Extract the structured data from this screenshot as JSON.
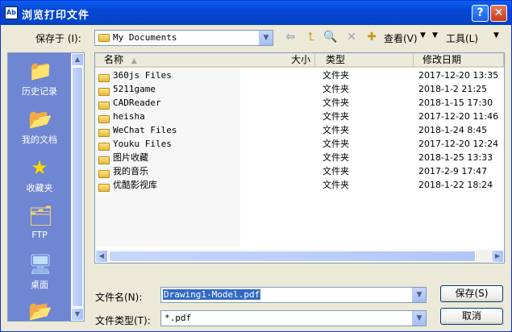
{
  "window": {
    "title": "浏览打印文件",
    "help_glyph": "?",
    "close_glyph": "✕",
    "app_icon_text": "Ab"
  },
  "lookin": {
    "label": "保存于 (I):",
    "value": "My Documents"
  },
  "toolbar": {
    "view_label": "查看(V)",
    "tools_label": "工具(L)"
  },
  "places": [
    {
      "label": "历史记录",
      "icon": "history-icon"
    },
    {
      "label": "我的文档",
      "icon": "my-documents-icon"
    },
    {
      "label": "收藏夹",
      "icon": "favorites-icon"
    },
    {
      "label": "FTP",
      "icon": "ftp-icon"
    },
    {
      "label": "桌面",
      "icon": "desktop-icon"
    }
  ],
  "columns": {
    "name": "名称",
    "size": "大小",
    "type": "类型",
    "modified": "修改日期"
  },
  "files": [
    {
      "name": "360js Files",
      "type": "文件夹",
      "modified": "2017-12-20 13:35",
      "icon": "folder-icon"
    },
    {
      "name": "5211game",
      "type": "文件夹",
      "modified": "2018-1-2 21:25",
      "icon": "folder-icon"
    },
    {
      "name": "CADReader",
      "type": "文件夹",
      "modified": "2018-1-15 17:30",
      "icon": "folder-icon"
    },
    {
      "name": "heisha",
      "type": "文件夹",
      "modified": "2017-12-20 11:46",
      "icon": "folder-icon"
    },
    {
      "name": "WeChat Files",
      "type": "文件夹",
      "modified": "2018-1-24 8:45",
      "icon": "folder-icon"
    },
    {
      "name": "Youku Files",
      "type": "文件夹",
      "modified": "2017-12-20 12:24",
      "icon": "folder-icon"
    },
    {
      "name": "图片收藏",
      "type": "文件夹",
      "modified": "2018-1-25 13:33",
      "icon": "pictures-folder-icon"
    },
    {
      "name": "我的音乐",
      "type": "文件夹",
      "modified": "2017-2-9 17:47",
      "icon": "music-folder-icon"
    },
    {
      "name": "优酷影视库",
      "type": "文件夹",
      "modified": "2018-1-22 18:24",
      "icon": "folder-icon"
    }
  ],
  "filename": {
    "label": "文件名(N):",
    "value": "Drawing1-Model.pdf"
  },
  "filetype": {
    "label": "文件类型(T):",
    "value": "*.pdf"
  },
  "buttons": {
    "save": "保存(S)",
    "cancel": "取消"
  },
  "colors": {
    "title_bar": "#0646d5",
    "places_bar": "#6f86d3",
    "selection": "#316ac5"
  }
}
